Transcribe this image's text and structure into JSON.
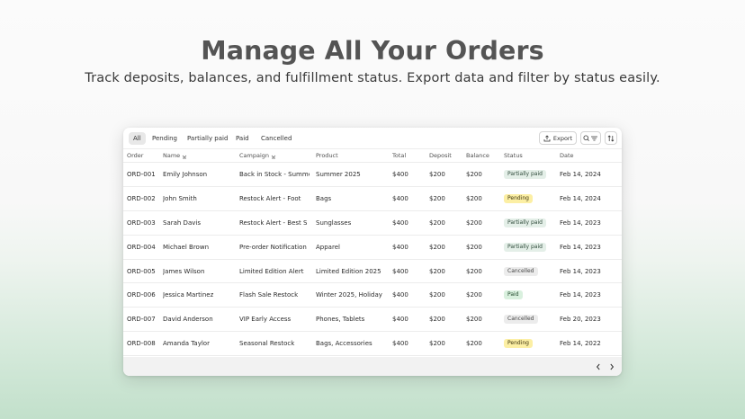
{
  "hero": {
    "title": "Manage All Your Orders",
    "subtitle": "Track deposits, balances, and fulfillment status. Export data and filter by status easily."
  },
  "tabs": [
    {
      "label": "All",
      "active": true
    },
    {
      "label": "Pending",
      "active": false
    },
    {
      "label": "Partially paid",
      "active": false
    },
    {
      "label": "Paid",
      "active": false
    },
    {
      "label": "Cancelled",
      "active": false
    }
  ],
  "toolbar": {
    "export_label": "Export",
    "export_icon": "upload-icon",
    "search_filter_icon": "search-filter-icon",
    "sort_icon": "sort-arrows-icon"
  },
  "columns": {
    "order": "Order",
    "name": "Name",
    "campaign": "Campaign",
    "product": "Product",
    "total": "Total",
    "deposit": "Deposit",
    "balance": "Balance",
    "status": "Status",
    "date": "Date"
  },
  "status_colors": {
    "Partially paid": {
      "bg": "#e4efe8",
      "fg": "#2f4a3a"
    },
    "Pending": {
      "bg": "#fcefa4",
      "fg": "#3d3410"
    },
    "Cancelled": {
      "bg": "#ececec",
      "fg": "#444444"
    },
    "Paid": {
      "bg": "#d9f0de",
      "fg": "#234a2d"
    }
  },
  "rows": [
    {
      "order": "ORD-001",
      "name": "Emily Johnson",
      "campaign": "Back in Stock - Summer",
      "product": "Summer 2025",
      "total": "$400",
      "deposit": "$200",
      "balance": "$200",
      "status": "Partially paid",
      "date": "Feb 14, 2024"
    },
    {
      "order": "ORD-002",
      "name": "John Smith",
      "campaign": "Restock Alert - Foot",
      "product": "Bags",
      "total": "$400",
      "deposit": "$200",
      "balance": "$200",
      "status": "Pending",
      "date": "Feb 14, 2024"
    },
    {
      "order": "ORD-003",
      "name": "Sarah Davis",
      "campaign": "Restock Alert - Best S",
      "product": "Sunglasses",
      "total": "$400",
      "deposit": "$200",
      "balance": "$200",
      "status": "Partially paid",
      "date": "Feb 14, 2023"
    },
    {
      "order": "ORD-004",
      "name": "Michael Brown",
      "campaign": "Pre-order Notification",
      "product": "Apparel",
      "total": "$400",
      "deposit": "$200",
      "balance": "$200",
      "status": "Partially paid",
      "date": "Feb 14, 2023"
    },
    {
      "order": "ORD-005",
      "name": "James Wilson",
      "campaign": "Limited Edition Alert",
      "product": "Limited Edition 2025",
      "total": "$400",
      "deposit": "$200",
      "balance": "$200",
      "status": "Cancelled",
      "date": "Feb 14, 2023"
    },
    {
      "order": "ORD-006",
      "name": "Jessica Martinez",
      "campaign": "Flash Sale Restock",
      "product": "Winter 2025, Holiday",
      "total": "$400",
      "deposit": "$200",
      "balance": "$200",
      "status": "Paid",
      "date": "Feb 14, 2023"
    },
    {
      "order": "ORD-007",
      "name": "David Anderson",
      "campaign": "VIP Early Access",
      "product": "Phones, Tablets",
      "total": "$400",
      "deposit": "$200",
      "balance": "$200",
      "status": "Cancelled",
      "date": "Feb 20, 2023"
    },
    {
      "order": "ORD-008",
      "name": "Amanda Taylor",
      "campaign": "Seasonal Restock",
      "product": "Bags, Accessories",
      "total": "$400",
      "deposit": "$200",
      "balance": "$200",
      "status": "Pending",
      "date": "Feb 14, 2022"
    }
  ],
  "pagination": {
    "prev_icon": "chevron-left-icon",
    "next_icon": "chevron-right-icon"
  }
}
